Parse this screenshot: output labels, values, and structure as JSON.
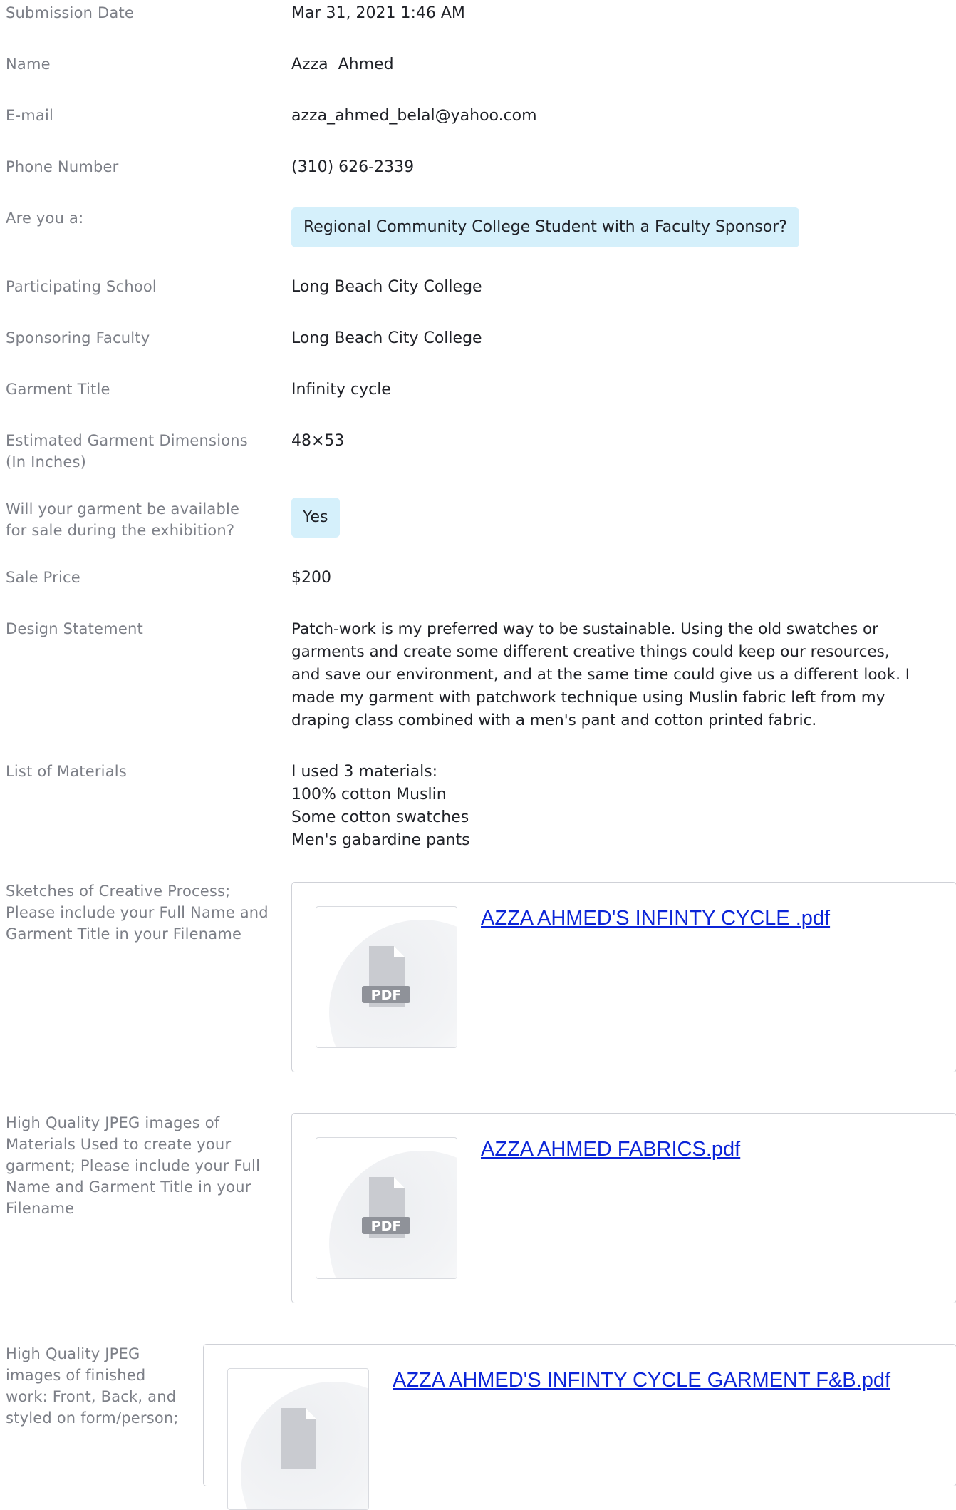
{
  "fields": {
    "submission_date": {
      "label": "Submission Date",
      "value": "Mar 31, 2021 1:46 AM"
    },
    "name": {
      "label": "Name",
      "value": "Azza  Ahmed"
    },
    "email": {
      "label": "E-mail",
      "value": "azza_ahmed_belal@yahoo.com"
    },
    "phone": {
      "label": "Phone Number",
      "value": "(310) 626-2339"
    },
    "are_you": {
      "label": "Are you a:",
      "value": "Regional Community College Student with a Faculty Sponsor?"
    },
    "school": {
      "label": "Participating School",
      "value": "Long Beach City College"
    },
    "faculty": {
      "label": "Sponsoring Faculty",
      "value": "Long Beach City College"
    },
    "garment_title": {
      "label": "Garment Title",
      "value": "Infinity cycle"
    },
    "dimensions": {
      "label_line1": "Estimated Garment Dimensions",
      "label_line2": "(In Inches)",
      "value": "48×53"
    },
    "for_sale": {
      "label_line1": "Will your garment be available",
      "label_line2": "for sale during the exhibition?",
      "value": "Yes"
    },
    "sale_price": {
      "label": "Sale Price",
      "value": "$200"
    },
    "design_statement": {
      "label": "Design Statement",
      "lines": [
        "Patch-work is my preferred way to be sustainable. Using the old swatches or",
        "garments and create some different creative things could keep our resources,",
        "and save our environment, and at the same time could give us a different look. I",
        "made my garment with patchwork technique using  Muslin fabric left from my",
        "draping class combined with a men's pant and cotton printed fabric."
      ]
    },
    "materials": {
      "label": "List of Materials",
      "lines": [
        "I used 3 materials:",
        "100% cotton Muslin",
        "Some cotton swatches",
        "Men's gabardine pants"
      ]
    },
    "sketches": {
      "label_lines": [
        "Sketches of Creative Process;",
        "Please include your Full Name and",
        "Garment Title in your Filename"
      ],
      "file": {
        "name": "AZZA AHMED'S INFINTY CYCLE .pdf",
        "badge": "PDF",
        "icon": "pdf-file-icon"
      }
    },
    "materials_images": {
      "label_lines": [
        "High Quality JPEG images of",
        "Materials Used to create your",
        "garment; Please include your Full",
        "Name and Garment Title in your",
        "Filename"
      ],
      "file": {
        "name": "AZZA AHMED FABRICS.pdf",
        "badge": "PDF",
        "icon": "pdf-file-icon"
      }
    },
    "finished_images": {
      "label_lines": [
        "High Quality JPEG",
        "images of finished",
        "work: Front, Back, and",
        "styled on form/person;"
      ],
      "file": {
        "name": "AZZA AHMED'S INFINTY CYCLE GARMENT F&B.pdf",
        "icon": "pdf-file-icon"
      }
    }
  },
  "colors": {
    "label": "#7c7f87",
    "value": "#1f2127",
    "chip_bg": "#d5f0fb",
    "link": "#0b24d8",
    "pdf_icon": "#c9cbd0",
    "pdf_badge": "#8f9299"
  }
}
